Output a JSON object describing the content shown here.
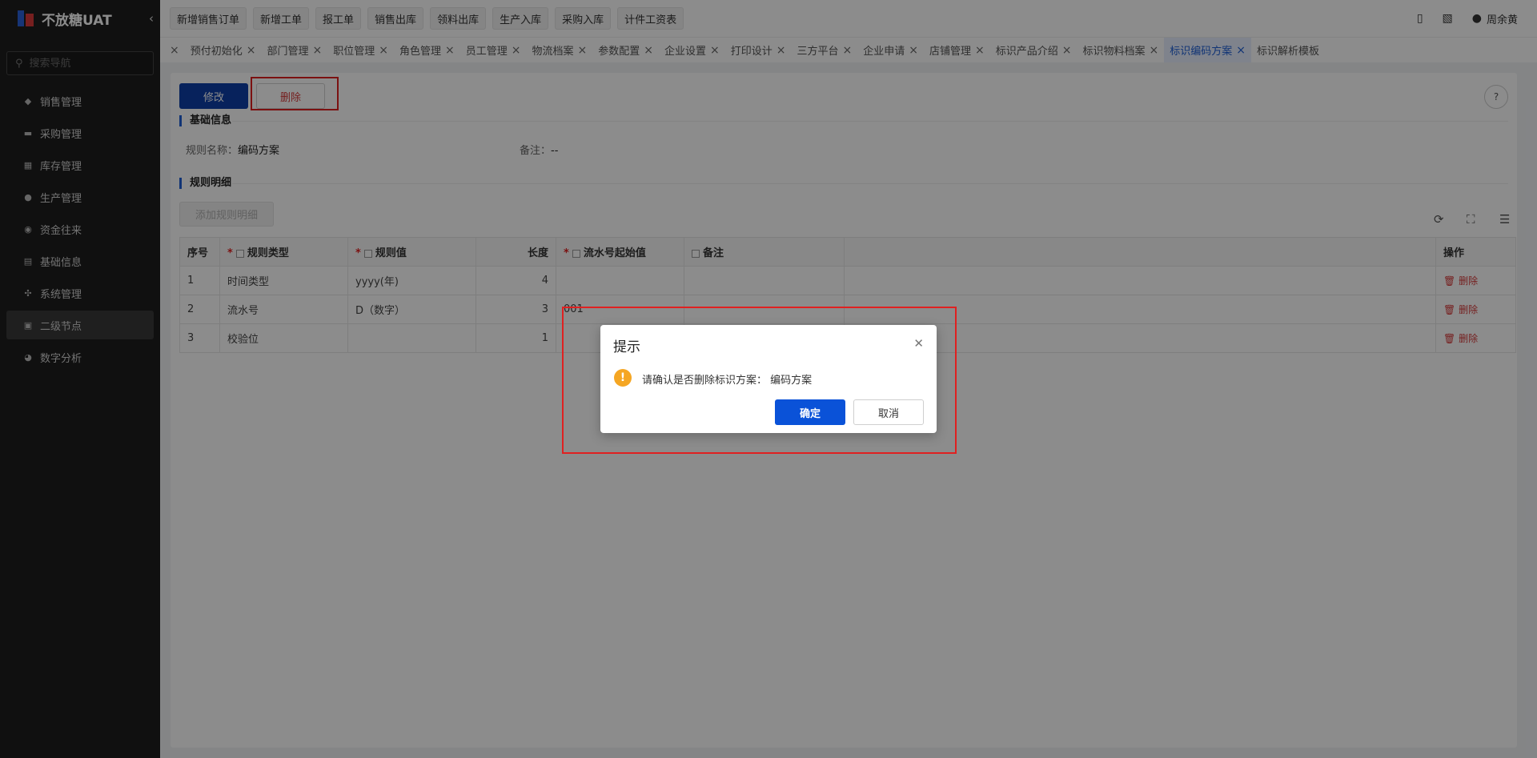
{
  "brand": {
    "title": "不放糖UAT"
  },
  "sidebar": {
    "search_placeholder": "搜索导航",
    "items": [
      {
        "label": "销售管理",
        "icon": "tag-icon"
      },
      {
        "label": "采购管理",
        "icon": "cart-icon"
      },
      {
        "label": "库存管理",
        "icon": "warehouse-icon"
      },
      {
        "label": "生产管理",
        "icon": "production-icon"
      },
      {
        "label": "资金往来",
        "icon": "money-icon"
      },
      {
        "label": "基础信息",
        "icon": "grid-icon"
      },
      {
        "label": "系统管理",
        "icon": "settings-icon"
      },
      {
        "label": "二级节点",
        "icon": "document-icon"
      },
      {
        "label": "数字分析",
        "icon": "pie-icon"
      }
    ]
  },
  "topbar": {
    "quick_buttons": [
      "新增销售订单",
      "新增工单",
      "报工单",
      "销售出库",
      "领料出库",
      "生产入库",
      "采购入库",
      "计件工资表"
    ],
    "user_name": "周余黄"
  },
  "tabs": [
    "预付初始化",
    "部门管理",
    "职位管理",
    "角色管理",
    "员工管理",
    "物流档案",
    "参数配置",
    "企业设置",
    "打印设计",
    "三方平台",
    "企业申请",
    "店铺管理",
    "标识产品介绍",
    "标识物料档案",
    "标识编码方案",
    "标识解析模板"
  ],
  "active_tab": "标识编码方案",
  "toolbar": {
    "edit_label": "修改",
    "delete_label": "删除"
  },
  "basic_info": {
    "section_title": "基础信息",
    "rule_name_label": "规则名称：",
    "rule_name_value": "编码方案",
    "remark_label": "备注：",
    "remark_value": "--"
  },
  "rules": {
    "section_title": "规则明细",
    "add_button": "添加规则明细",
    "columns": [
      "序号",
      "规则类型",
      "规则值",
      "长度",
      "流水号起始值",
      "备注",
      "操作"
    ],
    "rows": [
      {
        "index": "1",
        "type": "时间类型",
        "value": "yyyy(年)",
        "length": "4",
        "start": "",
        "remark": "",
        "action": "删除"
      },
      {
        "index": "2",
        "type": "流水号",
        "value": "D（数字）",
        "length": "3",
        "start": "001",
        "remark": "",
        "action": "删除"
      },
      {
        "index": "3",
        "type": "校验位",
        "value": "",
        "length": "1",
        "start": "",
        "remark": "",
        "action": "删除"
      }
    ]
  },
  "dialog": {
    "title": "提示",
    "message": "请确认是否删除标识方案：  编码方案",
    "ok": "确定",
    "cancel": "取消"
  },
  "colors": {
    "primary": "#0a52d8",
    "danger": "#d63a3a",
    "annotation": "#e02020",
    "warning": "#f5a623"
  }
}
